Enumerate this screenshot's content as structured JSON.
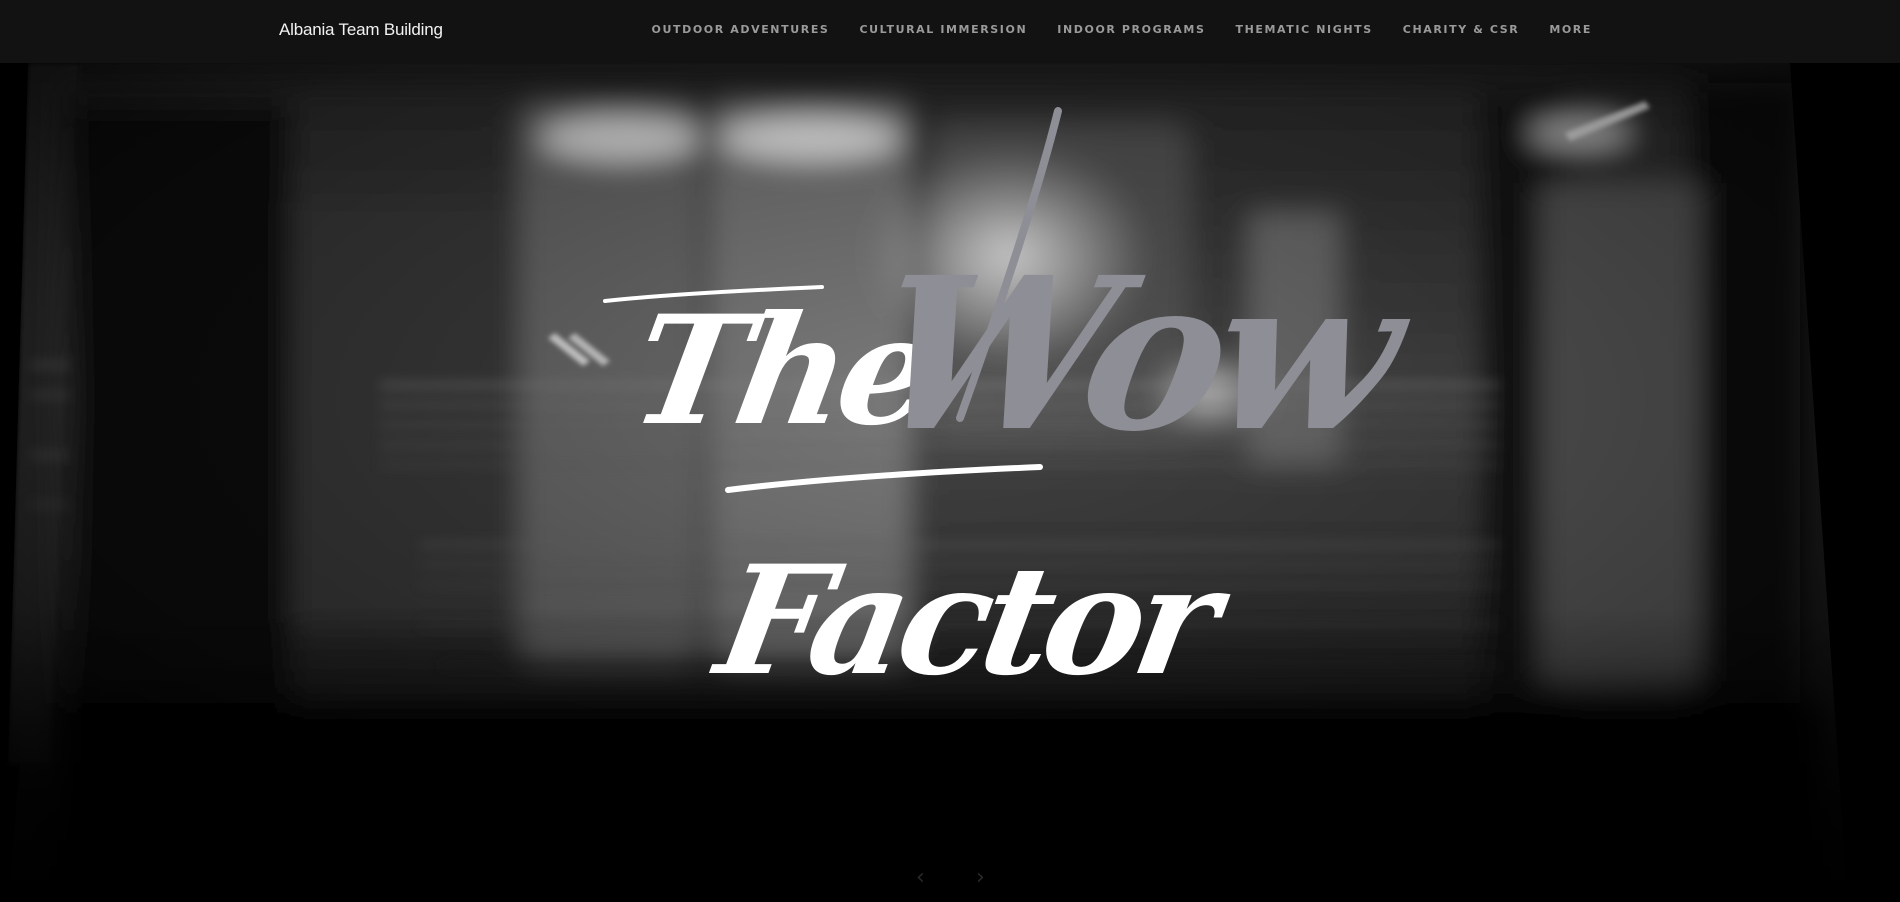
{
  "header": {
    "brand": "Albania Team Building",
    "nav": [
      {
        "label": "OUTDOOR ADVENTURES"
      },
      {
        "label": "CULTURAL IMMERSION"
      },
      {
        "label": "INDOOR PROGRAMS"
      },
      {
        "label": "THEMATIC NIGHTS"
      },
      {
        "label": "CHARITY & CSR"
      },
      {
        "label": "MORE"
      }
    ]
  },
  "hero": {
    "word_1": "The",
    "word_2": "Wow",
    "word_3": "Factor",
    "prev_icon": "chevron-left-icon",
    "next_icon": "chevron-right-icon"
  },
  "colors": {
    "topbar": "#121212",
    "headline_white": "#ffffff",
    "headline_accent": "#8e8e96"
  }
}
